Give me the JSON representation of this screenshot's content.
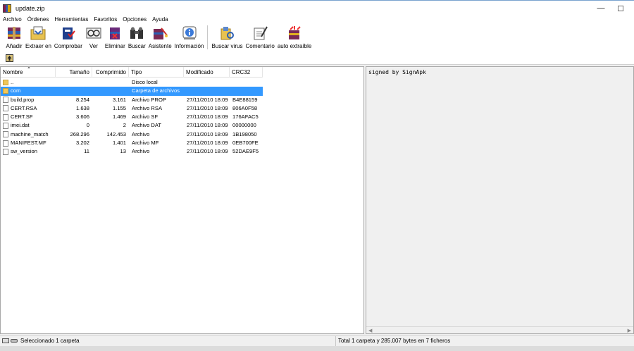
{
  "window": {
    "title": "update.zip"
  },
  "menu": [
    "Archivo",
    "Órdenes",
    "Herramientas",
    "Favoritos",
    "Opciones",
    "Ayuda"
  ],
  "toolbar": {
    "group1": [
      {
        "label": "Añadir",
        "icon": "add-archive-icon"
      },
      {
        "label": "Extraer en",
        "icon": "extract-icon"
      },
      {
        "label": "Comprobar",
        "icon": "test-icon"
      },
      {
        "label": "Ver",
        "icon": "view-icon"
      },
      {
        "label": "Eliminar",
        "icon": "delete-icon"
      },
      {
        "label": "Buscar",
        "icon": "find-icon"
      },
      {
        "label": "Asistente",
        "icon": "wizard-icon"
      },
      {
        "label": "Información",
        "icon": "info-icon"
      }
    ],
    "group2": [
      {
        "label": "Buscar virus",
        "icon": "virus-scan-icon"
      },
      {
        "label": "Comentario",
        "icon": "comment-icon"
      },
      {
        "label": "auto extraíble",
        "icon": "sfx-icon"
      }
    ]
  },
  "columns": {
    "name": "Nombre",
    "size": "Tamaño",
    "packed": "Comprimido",
    "type": "Tipo",
    "modified": "Modificado",
    "crc": "CRC32"
  },
  "files": [
    {
      "name": "..",
      "size": "",
      "packed": "",
      "type": "Disco local",
      "modified": "",
      "crc": "",
      "kind": "folder",
      "selected": false
    },
    {
      "name": "com",
      "size": "",
      "packed": "",
      "type": "Carpeta de archivos",
      "modified": "",
      "crc": "",
      "kind": "folder",
      "selected": true
    },
    {
      "name": "build.prop",
      "size": "8.254",
      "packed": "3.161",
      "type": "Archivo PROP",
      "modified": "27/11/2010 18:09",
      "crc": "B4E88159",
      "kind": "file",
      "selected": false
    },
    {
      "name": "CERT.RSA",
      "size": "1.638",
      "packed": "1.155",
      "type": "Archivo RSA",
      "modified": "27/11/2010 18:09",
      "crc": "806A0F58",
      "kind": "file",
      "selected": false
    },
    {
      "name": "CERT.SF",
      "size": "3.606",
      "packed": "1.469",
      "type": "Archivo SF",
      "modified": "27/11/2010 18:09",
      "crc": "176AFAC5",
      "kind": "file",
      "selected": false
    },
    {
      "name": "imei.dat",
      "size": "0",
      "packed": "2",
      "type": "Archivo DAT",
      "modified": "27/11/2010 18:09",
      "crc": "00000000",
      "kind": "file",
      "selected": false
    },
    {
      "name": "machine_match",
      "size": "268.296",
      "packed": "142.453",
      "type": "Archivo",
      "modified": "27/11/2010 18:09",
      "crc": "1B198050",
      "kind": "file",
      "selected": false
    },
    {
      "name": "MANIFEST.MF",
      "size": "3.202",
      "packed": "1.401",
      "type": "Archivo MF",
      "modified": "27/11/2010 18:09",
      "crc": "0EB700FE",
      "kind": "file",
      "selected": false
    },
    {
      "name": "sw_version",
      "size": "11",
      "packed": "13",
      "type": "Archivo",
      "modified": "27/11/2010 18:09",
      "crc": "52DAE9F5",
      "kind": "file",
      "selected": false
    }
  ],
  "comment": "signed by SignApk",
  "status": {
    "left": "Seleccionado 1 carpeta",
    "right": "Total 1 carpeta y 285.007 bytes en 7 ficheros"
  },
  "colors": {
    "selection": "#3399ff",
    "folder": "#f0c75a"
  }
}
